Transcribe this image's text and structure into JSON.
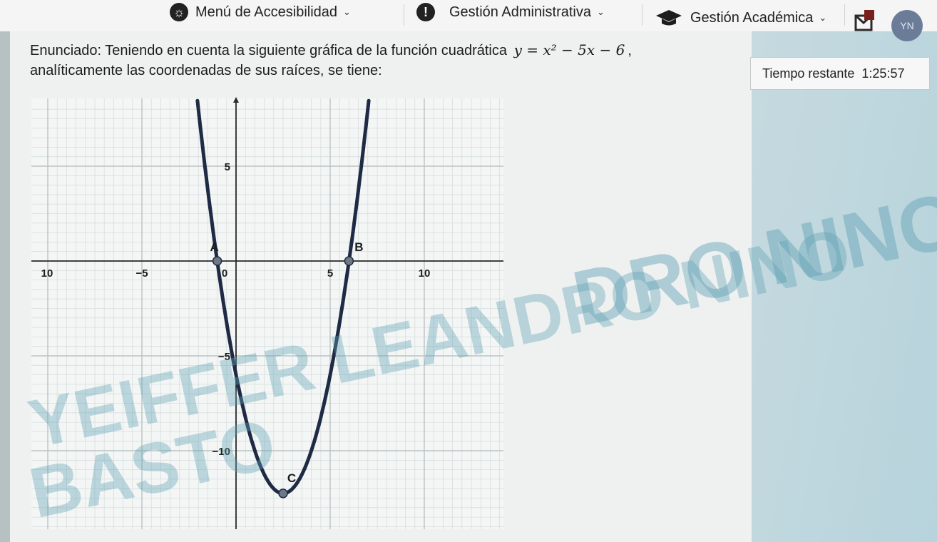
{
  "nav": {
    "accessibility": "Menú de Accesibilidad",
    "admin": "Gestión Administrativa",
    "academic": "Gestión Académica",
    "avatar": "YN"
  },
  "question": {
    "prefix": "Enunciado: Teniendo en cuenta la siguiente gráfica de la función cuadrática",
    "formula": "y = x² − 5x − 6",
    "suffix": "analíticamente las coordenadas de sus raíces, se tiene:"
  },
  "timer": {
    "label": "Tiempo restante",
    "value": "1:25:57"
  },
  "watermark": {
    "line1": "DRO NINO",
    "line2": "YEIFFER LEANDRO NINO",
    "line3": "BASTO"
  },
  "chart_data": {
    "type": "line",
    "function": "y = x^2 - 5x - 6",
    "x_ticks": [
      {
        "value": -10,
        "label": "10"
      },
      {
        "value": -5,
        "label": "−5"
      },
      {
        "value": 0,
        "label": "0"
      },
      {
        "value": 5,
        "label": "5"
      },
      {
        "value": 10,
        "label": "10"
      }
    ],
    "y_ticks": [
      {
        "value": 5,
        "label": "5"
      },
      {
        "value": -5,
        "label": "−5"
      },
      {
        "value": -10,
        "label": "−10"
      }
    ],
    "xlim": [
      -10,
      14
    ],
    "ylim": [
      -14,
      8
    ],
    "points": [
      {
        "label": "A",
        "x": -1,
        "y": 0
      },
      {
        "label": "B",
        "x": 6,
        "y": 0
      },
      {
        "label": "C",
        "x": 2.5,
        "y": -12.25
      }
    ],
    "grid": true
  }
}
